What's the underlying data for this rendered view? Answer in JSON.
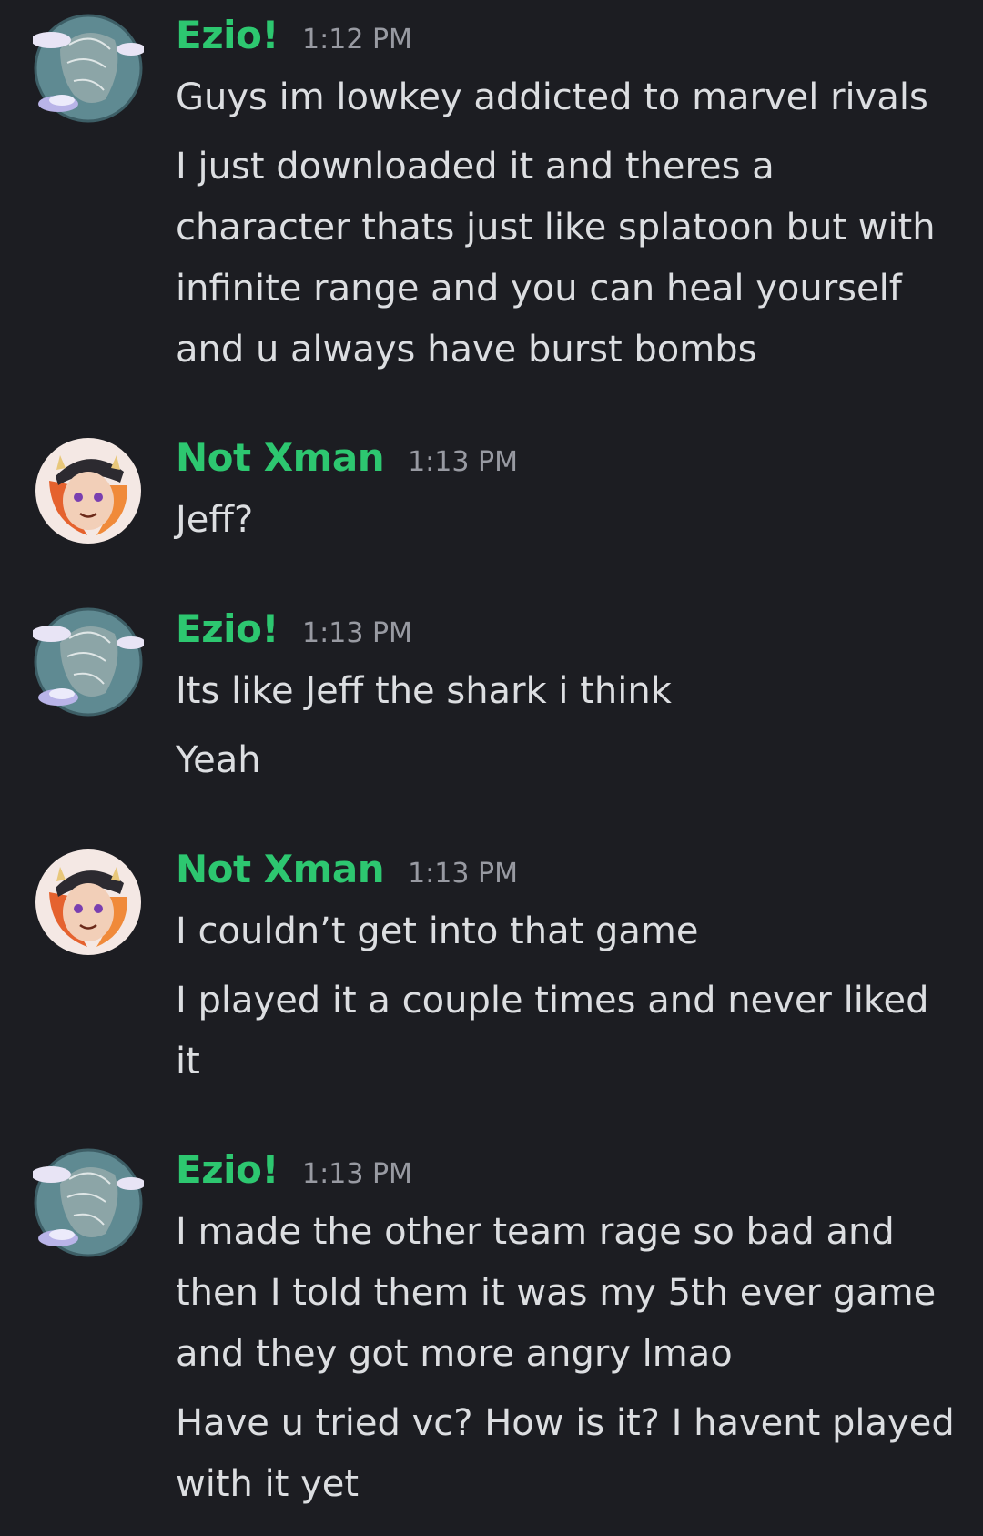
{
  "messages": [
    {
      "author": "Ezio!",
      "time": "1:12 PM",
      "avatar": "ezio-avatar",
      "lines": [
        "Guys im lowkey addicted to marvel rivals",
        "I just downloaded it and theres a character thats just like splatoon but with infinite range and you can heal yourself and u always have burst bombs"
      ]
    },
    {
      "author": "Not Xman",
      "time": "1:13 PM",
      "avatar": "xman-avatar",
      "lines": [
        "Jeff?"
      ]
    },
    {
      "author": "Ezio!",
      "time": "1:13 PM",
      "avatar": "ezio-avatar",
      "lines": [
        "Its like Jeff the shark i think",
        "Yeah"
      ]
    },
    {
      "author": "Not Xman",
      "time": "1:13 PM",
      "avatar": "xman-avatar",
      "lines": [
        "I couldn’t get into that game",
        "I played it a couple times and never liked it"
      ]
    },
    {
      "author": "Ezio!",
      "time": "1:13 PM",
      "avatar": "ezio-avatar",
      "lines": [
        "I made the other team rage so bad and then I told them it was my 5th ever game and they got more angry lmao",
        "Have u tried vc? How is it? I havent played with it yet"
      ]
    }
  ],
  "colors": {
    "background": "#1c1d22",
    "username": "#2dc770",
    "timestamp": "#989aa2",
    "text": "#dcdee1"
  }
}
